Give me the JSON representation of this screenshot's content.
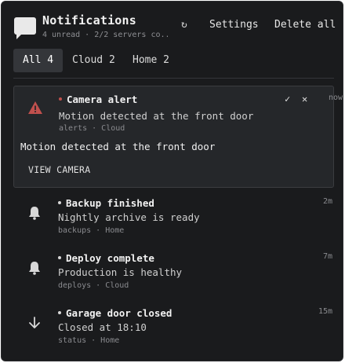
{
  "header": {
    "title": "Notifications",
    "subtitle": "4 unread · 2/2 servers co...",
    "refresh_glyph": "↻",
    "settings_label": "Settings",
    "delete_all_label": "Delete all"
  },
  "tabs": [
    {
      "label": "All 4",
      "active": true
    },
    {
      "label": "Cloud 2",
      "active": false
    },
    {
      "label": "Home 2",
      "active": false
    }
  ],
  "notifications": [
    {
      "title": "Camera alert",
      "icon": "warning-icon",
      "icon_color": "#c0504d",
      "dot_color": "#c0504d",
      "message": "Motion detected at the front door",
      "meta": "alerts · Cloud",
      "time": "now",
      "expanded": true,
      "detail": "Motion detected at the front door",
      "action_label": "VIEW CAMERA",
      "check_glyph": "✓",
      "close_glyph": "✕"
    },
    {
      "title": "Backup finished",
      "icon": "bell-icon",
      "message": "Nightly archive is ready",
      "meta": "backups · Home",
      "time": "2m"
    },
    {
      "title": "Deploy complete",
      "icon": "bell-icon",
      "message": "Production is healthy",
      "meta": "deploys · Cloud",
      "time": "7m"
    },
    {
      "title": "Garage door closed",
      "icon": "arrow-down-icon",
      "message": "Closed at 18:10",
      "meta": "status · Home",
      "time": "15m"
    }
  ],
  "colors": {
    "panel_bg": "#1a1b1d",
    "card_bg": "#25272a",
    "active_tab_bg": "#34363a",
    "alert": "#c0504d"
  }
}
